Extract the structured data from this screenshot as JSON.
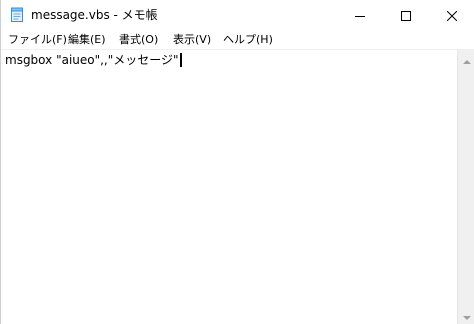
{
  "window": {
    "title": "message.vbs - メモ帳",
    "icon": "notepad-icon",
    "controls": {
      "minimize_icon": "minimize-icon",
      "maximize_icon": "maximize-icon",
      "close_icon": "close-icon"
    }
  },
  "menubar": {
    "items": [
      {
        "label": "ファイル(F)"
      },
      {
        "label": "編集(E)"
      },
      {
        "label": "書式(O)"
      },
      {
        "label": "表示(V)"
      },
      {
        "label": "ヘルプ(H)"
      }
    ]
  },
  "editor": {
    "content": "msgbox \"aiueo\",,\"メッセージ\""
  },
  "colors": {
    "background": "#ffffff",
    "text": "#000000",
    "scrollbar": "#f0f0f0"
  }
}
